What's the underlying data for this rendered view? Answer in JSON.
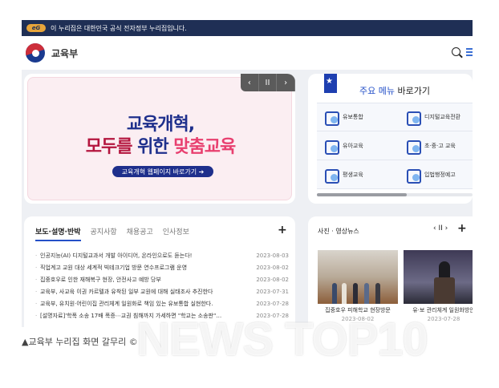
{
  "gov_bar": {
    "badge": "eG",
    "text": "이 누리집은 대한민국 공식 전자정부 누리집입니다."
  },
  "header": {
    "site_name": "교육부"
  },
  "banner": {
    "line1": "교육개혁,",
    "line2_a": "모두를",
    "line2_b": " 위한 ",
    "line2_c": "맞춤교육",
    "button": "교육개혁 웹페이지 바로가기 ➔",
    "controls": {
      "prev": "‹",
      "pause": "II",
      "next": "›"
    }
  },
  "quick_menu": {
    "title_highlight": "주요 메뉴",
    "title_rest": " 바로가기",
    "items": [
      {
        "label": "유보통합",
        "icon": "people-icon"
      },
      {
        "label": "디지털교육전환",
        "icon": "computer-icon"
      },
      {
        "label": "유아교육",
        "icon": "child-icon"
      },
      {
        "label": "초·중·고 교육",
        "icon": "book-icon"
      },
      {
        "label": "평생교육",
        "icon": "monitor-icon"
      },
      {
        "label": "입법행정예고",
        "icon": "document-icon"
      }
    ]
  },
  "news": {
    "tabs": [
      "보도·설명·반박",
      "공지사항",
      "채용공고",
      "인사정보"
    ],
    "plus": "+",
    "rows": [
      {
        "title": "인공지능(AI) 디지털교과서 개발 아이디어, 온라인으로도 듣는다!",
        "date": "2023-08-03"
      },
      {
        "title": "직업계고 교원 대상 세계적 빅테크기업 방문 연수프로그램 운영",
        "date": "2023-08-02"
      },
      {
        "title": "집중호우로 인한 재해복구 현장, 안전사고 예방 당부",
        "date": "2023-08-02"
      },
      {
        "title": "교육부, 사교육 이권 카르텔과 유착된 일부 교원에 대해 실태조사 추진한다",
        "date": "2023-07-31"
      },
      {
        "title": "교육부, 유치원·어린이집 관리체계 일원화로 책임 있는 유보통합 실현한다.",
        "date": "2023-07-28"
      },
      {
        "title": "[설명자료]'학폭 소송 17배 폭증⋯교권 침해까지 가세하면 \"학교는 소송판\"…",
        "date": "2023-07-28"
      }
    ]
  },
  "photo_news": {
    "title": "사진 · 영상뉴스",
    "controls": "‹ II ›",
    "plus": "+",
    "items": [
      {
        "caption": "집중호우 피해학교 현장방문",
        "date": "2023-08-02"
      },
      {
        "caption": "유·보 관리체계 일원화방안",
        "date": "2023-07-28"
      }
    ]
  },
  "caption": "▲교육부 누리집 화면 갈무리 ©",
  "watermark": "NEWS TOP10",
  "colors": {
    "gov_bar": "#1f2f55",
    "accent_blue": "#2450c8",
    "banner_red": "#b4153e"
  }
}
